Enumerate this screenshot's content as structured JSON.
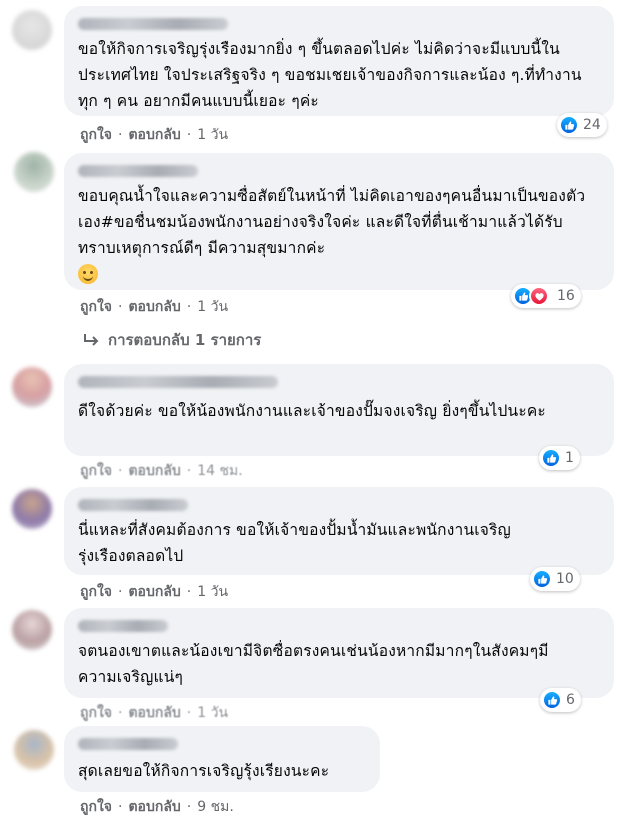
{
  "comments": [
    {
      "text": "ขอให้กิจการเจริญรุ่งเรืองมากยิ่ง ๆ ขึ้นตลอดไปค่ะ ไม่คิดว่าจะมีแบบนี้ในประเทศไทย ใจประเสริฐจริง ๆ ขอชมเชยเจ้าของกิจการและน้อง ๆ.ที่ทำงานทุก ๆ คน อยากมีคนแบบนี้เยอะ ๆค่ะ",
      "like": "ถูกใจ",
      "sep": "·",
      "reply": "ตอบกลับ",
      "time": "1 วัน",
      "reaction_count": "24",
      "reactions": [
        "like"
      ]
    },
    {
      "text": "ขอบคุณน้ำใจและความซื่อสัตย์ในหน้าที่ ไม่คิดเอาของๆคนอื่นมาเป็นของตัวเอง#ขอชื่นชมน้องพนักงานอย่างจริงใจค่ะ และดีใจที่ตื่นเช้ามาแล้วได้รับทราบเหตุการณ์ดีๆ มีความสุขมากค่ะ",
      "emoji": "smiling-face",
      "like": "ถูกใจ",
      "sep": "·",
      "reply": "ตอบกลับ",
      "time": "1 วัน",
      "reaction_count": "16",
      "reactions": [
        "like",
        "love"
      ],
      "replies_label": "การตอบกลับ 1 รายการ"
    },
    {
      "text": "ดีใจด้วยค่ะ ขอให้น้องพนักงานและเจ้าของปั๊มจงเจริญ ยิ่งๆขึ้นไปนะคะ",
      "like": "ถูกใจ",
      "sep": "·",
      "reply": "ตอบกลับ",
      "time": "14 ชม.",
      "reaction_count": "1",
      "reactions": [
        "like"
      ]
    },
    {
      "text": "นี่แหละที่สังคมต้องการ ขอให้เจ้าของปั้มน้ำมันและพนักงานเจริญรุ่งเรืองตลอดไป",
      "like": "ถูกใจ",
      "sep": "·",
      "reply": "ตอบกลับ",
      "time": "1 วัน",
      "reaction_count": "10",
      "reactions": [
        "like"
      ]
    },
    {
      "text": "จตนองเขาตและน้องเขามีจิตซื่อตรงคนเช่นน้องหากมีมากๆในสังคมๆมีความเจริญแน่ๆ",
      "like": "ถูกใจ",
      "sep": "·",
      "reply": "ตอบกลับ",
      "time": "1 วัน",
      "reaction_count": "6",
      "reactions": [
        "like"
      ]
    },
    {
      "text": "สุดเลยขอให้กิจการเจริญรุ้งเรียงนะคะ",
      "like": "ถูกใจ",
      "sep": "·",
      "reply": "ตอบกลับ",
      "time": "9 ชม."
    }
  ],
  "colors": {
    "bubble": "#f0f2f5",
    "meta": "#65676b",
    "like_blue": "#1877f2",
    "love_red": "#f33e58"
  }
}
